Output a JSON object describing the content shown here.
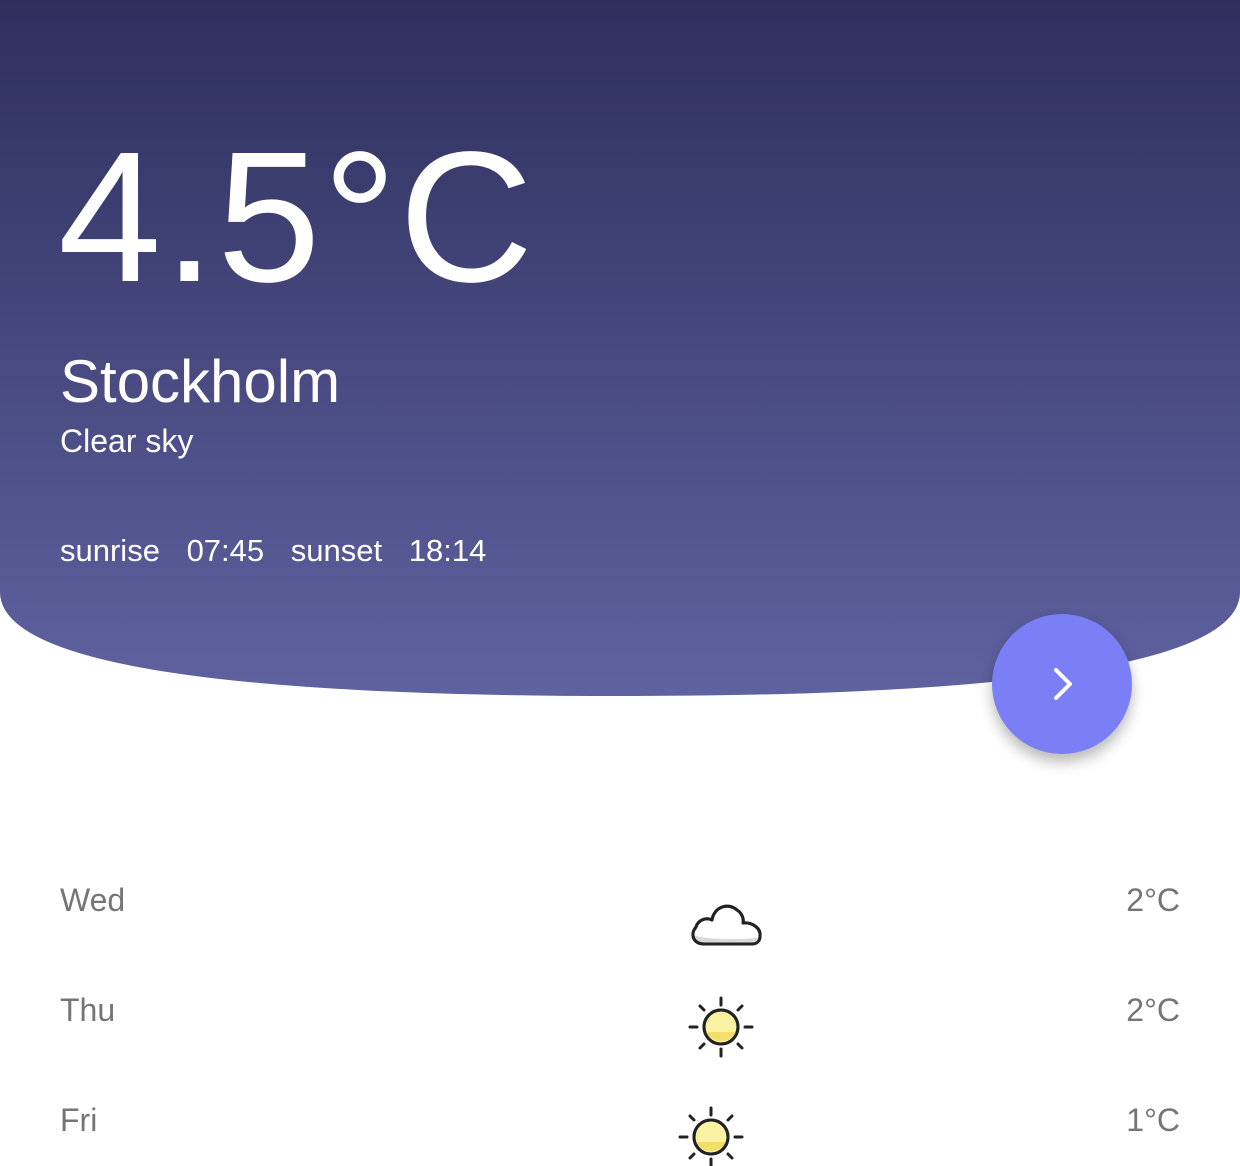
{
  "current": {
    "temperature": "4.5°C",
    "city": "Stockholm",
    "condition": "Clear sky",
    "sunrise_label": "sunrise",
    "sunrise_time": "07:45",
    "sunset_label": "sunset",
    "sunset_time": "18:14"
  },
  "colors": {
    "header_top": "#2e2f5d",
    "header_bottom": "#5f62a0",
    "fab": "#7b7ff5",
    "forecast_text": "#757575"
  },
  "fab": {
    "icon": "chevron-right-icon"
  },
  "forecast": [
    {
      "day": "Wed",
      "icon": "cloud-icon",
      "temp": "2°C"
    },
    {
      "day": "Thu",
      "icon": "sun-icon",
      "temp": "2°C"
    },
    {
      "day": "Fri",
      "icon": "sun-icon",
      "temp": "1°C"
    }
  ]
}
